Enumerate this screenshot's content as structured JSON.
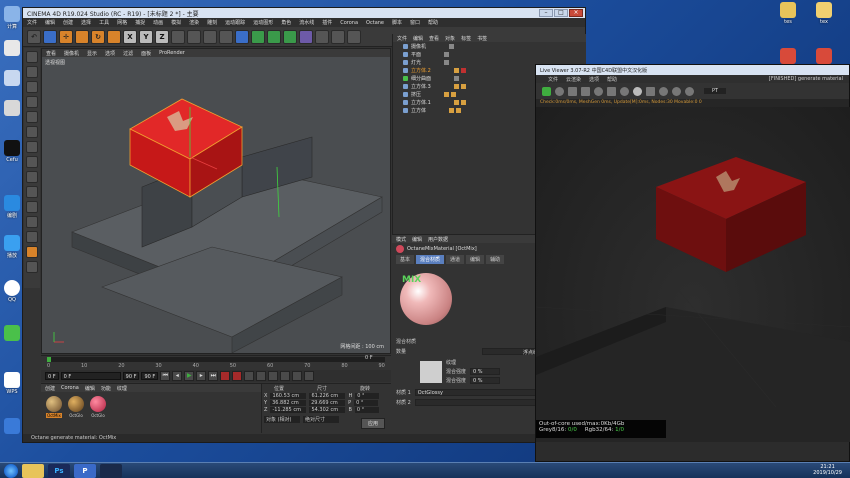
{
  "desktop": {
    "left_icons": [
      "计算",
      "",
      "",
      "Cefu",
      "Exper",
      "",
      "",
      "",
      "编剧",
      "播放",
      "",
      "QQ",
      "",
      "",
      "WPS",
      "",
      ""
    ],
    "right_icons": [
      "tes",
      "tex",
      "",
      ""
    ]
  },
  "c4d": {
    "title": "CINEMA 4D R19.024 Studio (RC - R19) - [未标题 2 *] - 主要",
    "menu": [
      "文件",
      "编辑",
      "创建",
      "选择",
      "工具",
      "网格",
      "捕捉",
      "动画",
      "模拟",
      "渲染",
      "雕刻",
      "运动跟踪",
      "运动图形",
      "角色",
      "流水线",
      "插件",
      "Corona",
      "Octane",
      "脚本",
      "窗口",
      "帮助"
    ],
    "toolbar_xyz": [
      "X",
      "Y",
      "Z"
    ],
    "viewport_menu": [
      "查看",
      "摄像机",
      "显示",
      "选项",
      "过滤",
      "面板",
      "ProRender"
    ],
    "viewport_label": "透视视图",
    "grid_info": "网格间距 : 100 cm",
    "objects": [
      {
        "name": "摄像机"
      },
      {
        "name": "平面"
      },
      {
        "name": "灯光"
      },
      {
        "name": "立方体.2"
      },
      {
        "name": "细分曲面"
      },
      {
        "name": "立方体.3"
      },
      {
        "name": "挤压"
      },
      {
        "name": "立方体.1"
      },
      {
        "name": "立方体"
      }
    ],
    "obj_menu": [
      "文件",
      "编辑",
      "查看",
      "对象",
      "标签",
      "书签"
    ],
    "attr_menu": [
      "模式",
      "编辑",
      "用户数据"
    ],
    "attr_title": "OctaneMixMaterial [OctMix]",
    "attr_tabs": [
      "基本",
      "混合材质",
      "通道",
      "编辑",
      "辅助"
    ],
    "attr_mix_label": "MIX",
    "attr_section": "混合材质",
    "attr_rows": [
      {
        "label": "数量",
        "value": "浮点纹理"
      },
      {
        "label": "纹理",
        "value": ""
      },
      {
        "label": "混合强度",
        "value": "0 %"
      },
      {
        "label": "混合强度",
        "value": "0 %"
      },
      {
        "label": "材质 1",
        "value": "OctGlossy"
      },
      {
        "label": "材质 2",
        "value": ""
      }
    ],
    "timeline_ticks": [
      "0",
      "10",
      "20",
      "30",
      "40",
      "50",
      "60",
      "70",
      "80",
      "90"
    ],
    "timeline_current": "0 F",
    "play_fields": [
      "0 F",
      "0 F",
      "90 F",
      "90 F"
    ],
    "mat_menu": [
      "创建",
      "Corona",
      "编辑",
      "功能",
      "纹理"
    ],
    "materials": [
      {
        "name": "OctMix",
        "color": "#8a6a4a",
        "selected": true
      },
      {
        "name": "OctGlo",
        "color": "#7a6040",
        "selected": false
      },
      {
        "name": "OctGlo",
        "color": "#d0485a",
        "selected": false
      }
    ],
    "coords_headers": [
      "位置",
      "尺寸",
      "旋转"
    ],
    "coords_rows": [
      {
        "axis": "X",
        "pos": "160.53 cm",
        "size": "61.226 cm",
        "rotLabel": "H",
        "rot": "0 °"
      },
      {
        "axis": "Y",
        "pos": "36.882 cm",
        "size": "29.669 cm",
        "rotLabel": "P",
        "rot": "0 °"
      },
      {
        "axis": "Z",
        "pos": "-11.285 cm",
        "size": "54.302 cm",
        "rotLabel": "B",
        "rot": "0 °"
      }
    ],
    "coords_mode": "对象 (相对)",
    "coords_size_mode": "绝对尺寸",
    "apply_label": "应用",
    "status": "Octane generate material: OctMix"
  },
  "live_viewer": {
    "title": "Live Viewer 3.07-R2 中国C4D联盟中文汉化版",
    "menu": [
      "文件",
      "云渲染",
      "选项",
      "帮助"
    ],
    "menu_right": "[FINISHED] generate material",
    "info": "Check:0ms/0ms, MeshGen 0ms, Update[M]:0ms, Nodes:30 Movable:0 0",
    "pt_label": "PT",
    "stats_line1": "Out-of-core used/max:0Kb/4Gb",
    "stats_grey": "Grey8/16:",
    "stats_grey_val": "0/0",
    "stats_rgb": "Rgb32/64:",
    "stats_rgb_val": "1/0"
  },
  "taskbar": {
    "time": "21:21",
    "date": "2019/10/29"
  },
  "colors": {
    "box_red": "#d81818",
    "accent_orange": "#d8832a",
    "octane_green": "#3fae3f"
  }
}
